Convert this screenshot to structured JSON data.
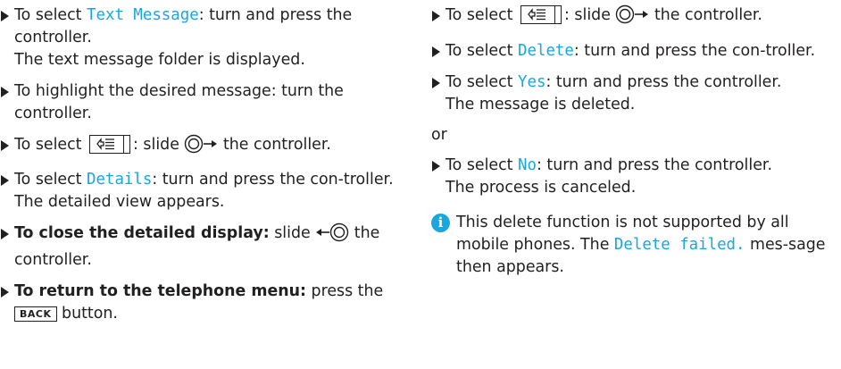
{
  "left": {
    "s1_pre": "To select ",
    "s1_term": "Text Message",
    "s1_post": ": turn and press the controller.",
    "s1_result": "The text message folder is displayed.",
    "s2": "To highlight the desired message: turn the controller.",
    "s3_pre": "To select ",
    "s3_mid": ": slide ",
    "s3_post": " the controller.",
    "s4_pre": "To select ",
    "s4_term": "Details",
    "s4_post": ": turn and press the con-troller.",
    "s4_result": "The detailed view appears.",
    "s5_bold": "To close the detailed display:",
    "s5_mid": " slide ",
    "s5_post": " the controller.",
    "s6_bold": "To return to the telephone menu:",
    "s6_mid": " press the ",
    "s6_key": "BACK",
    "s6_post": " button."
  },
  "right": {
    "r1_pre": "To select ",
    "r1_mid": ": slide ",
    "r1_post": " the controller.",
    "r2_pre": "To select ",
    "r2_term": "Delete",
    "r2_post": ": turn and press the con-troller.",
    "r3_pre": "To select ",
    "r3_term": "Yes",
    "r3_post": ": turn and press the controller.",
    "r3_result": "The message is deleted.",
    "or": "or",
    "r4_pre": "To select ",
    "r4_term": "No",
    "r4_post": ": turn and press the controller.",
    "r4_result": "The process is canceled.",
    "note_pre": "This delete function is not supported by all mobile phones. The ",
    "note_term": "Delete failed.",
    "note_post": " mes-sage then appears.",
    "info_glyph": "i"
  },
  "colors": {
    "text": "#231f20",
    "accent": "#1aa6df"
  },
  "icons": [
    "menu-key-icon",
    "controller-slide-right-icon",
    "controller-slide-left-icon",
    "back-key-icon",
    "info-icon",
    "bullet-triangle-icon"
  ]
}
